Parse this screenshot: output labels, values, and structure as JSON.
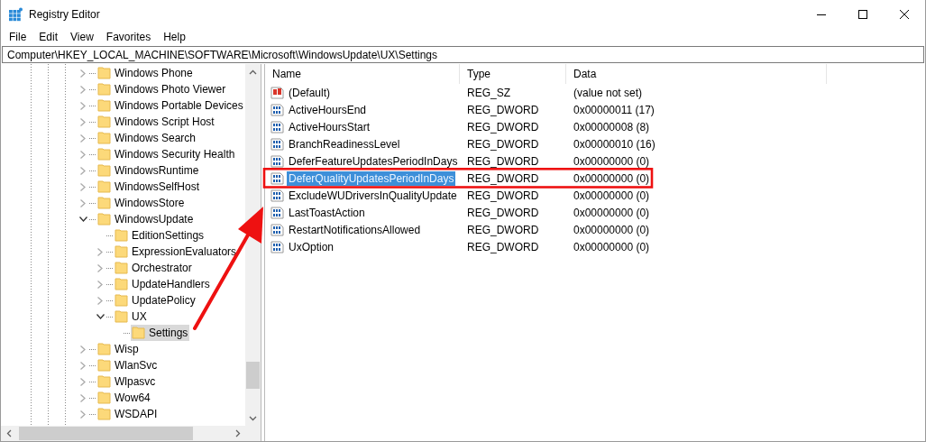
{
  "window": {
    "title": "Registry Editor"
  },
  "menu": [
    "File",
    "Edit",
    "View",
    "Favorites",
    "Help"
  ],
  "address": "Computer\\HKEY_LOCAL_MACHINE\\SOFTWARE\\Microsoft\\WindowsUpdate\\UX\\Settings",
  "tree": [
    {
      "label": "Windows Phone",
      "expandable": true,
      "expanded": false,
      "selected": false
    },
    {
      "label": "Windows Photo Viewer",
      "expandable": true,
      "expanded": false,
      "selected": false
    },
    {
      "label": "Windows Portable Devices",
      "expandable": true,
      "expanded": false,
      "selected": false
    },
    {
      "label": "Windows Script Host",
      "expandable": true,
      "expanded": false,
      "selected": false
    },
    {
      "label": "Windows Search",
      "expandable": true,
      "expanded": false,
      "selected": false
    },
    {
      "label": "Windows Security Health",
      "expandable": true,
      "expanded": false,
      "selected": false
    },
    {
      "label": "WindowsRuntime",
      "expandable": true,
      "expanded": false,
      "selected": false
    },
    {
      "label": "WindowsSelfHost",
      "expandable": true,
      "expanded": false,
      "selected": false
    },
    {
      "label": "WindowsStore",
      "expandable": true,
      "expanded": false,
      "selected": false
    },
    {
      "label": "WindowsUpdate",
      "expandable": true,
      "expanded": true,
      "selected": false,
      "children": [
        {
          "label": "EditionSettings",
          "selected": false
        },
        {
          "label": "ExpressionEvaluators",
          "expandable": true,
          "expanded": false,
          "selected": false
        },
        {
          "label": "Orchestrator",
          "expandable": true,
          "expanded": false,
          "selected": false
        },
        {
          "label": "UpdateHandlers",
          "expandable": true,
          "expanded": false,
          "selected": false
        },
        {
          "label": "UpdatePolicy",
          "expandable": true,
          "expanded": false,
          "selected": false
        },
        {
          "label": "UX",
          "expandable": true,
          "expanded": true,
          "selected": false,
          "children": [
            {
              "label": "Settings",
              "selected": true
            }
          ]
        }
      ]
    },
    {
      "label": "Wisp",
      "expandable": true,
      "expanded": false,
      "selected": false
    },
    {
      "label": "WlanSvc",
      "expandable": true,
      "expanded": false,
      "selected": false
    },
    {
      "label": "Wlpasvc",
      "expandable": true,
      "expanded": false,
      "selected": false
    },
    {
      "label": "Wow64",
      "expandable": true,
      "expanded": false,
      "selected": false
    },
    {
      "label": "WSDAPI",
      "expandable": true,
      "expanded": false,
      "selected": false
    }
  ],
  "table": {
    "columns": [
      "Name",
      "Type",
      "Data"
    ],
    "rows": [
      {
        "kind": "string",
        "name": "(Default)",
        "type": "REG_SZ",
        "data": "(value not set)",
        "selected": false
      },
      {
        "kind": "binary",
        "name": "ActiveHoursEnd",
        "type": "REG_DWORD",
        "data": "0x00000011 (17)",
        "selected": false
      },
      {
        "kind": "binary",
        "name": "ActiveHoursStart",
        "type": "REG_DWORD",
        "data": "0x00000008 (8)",
        "selected": false
      },
      {
        "kind": "binary",
        "name": "BranchReadinessLevel",
        "type": "REG_DWORD",
        "data": "0x00000010 (16)",
        "selected": false
      },
      {
        "kind": "binary",
        "name": "DeferFeatureUpdatesPeriodInDays",
        "type": "REG_DWORD",
        "data": "0x00000000 (0)",
        "selected": false
      },
      {
        "kind": "binary",
        "name": "DeferQualityUpdatesPeriodInDays",
        "type": "REG_DWORD",
        "data": "0x00000000 (0)",
        "selected": true
      },
      {
        "kind": "binary",
        "name": "ExcludeWUDriversInQualityUpdate",
        "type": "REG_DWORD",
        "data": "0x00000000 (0)",
        "selected": false
      },
      {
        "kind": "binary",
        "name": "LastToastAction",
        "type": "REG_DWORD",
        "data": "0x00000000 (0)",
        "selected": false
      },
      {
        "kind": "binary",
        "name": "RestartNotificationsAllowed",
        "type": "REG_DWORD",
        "data": "0x00000000 (0)",
        "selected": false
      },
      {
        "kind": "binary",
        "name": "UxOption",
        "type": "REG_DWORD",
        "data": "0x00000000 (0)",
        "selected": false
      }
    ]
  }
}
